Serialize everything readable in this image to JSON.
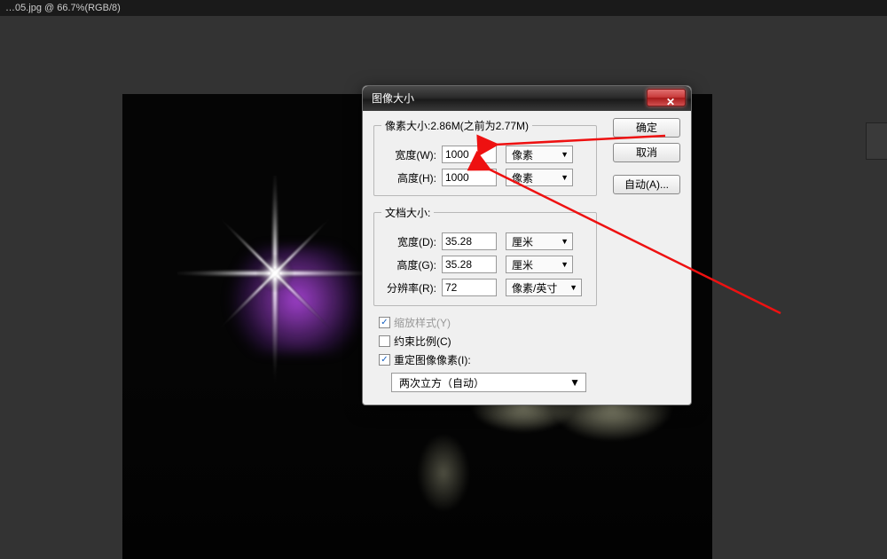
{
  "tab": {
    "title": "…05.jpg @ 66.7%(RGB/8)"
  },
  "dialog": {
    "title": "图像大小",
    "buttons": {
      "ok": "确定",
      "cancel": "取消",
      "auto": "自动(A)..."
    },
    "pixelDims": {
      "legend": "像素大小:2.86M(之前为2.77M)",
      "widthLabel": "宽度(W):",
      "widthValue": "1000",
      "widthUnit": "像素",
      "heightLabel": "高度(H):",
      "heightValue": "1000",
      "heightUnit": "像素"
    },
    "docSize": {
      "legend": "文档大小:",
      "widthLabel": "宽度(D):",
      "widthValue": "35.28",
      "widthUnit": "厘米",
      "heightLabel": "高度(G):",
      "heightValue": "35.28",
      "heightUnit": "厘米",
      "resLabel": "分辨率(R):",
      "resValue": "72",
      "resUnit": "像素/英寸"
    },
    "scaleStyles": "缩放样式(Y)",
    "constrain": "约束比例(C)",
    "resample": "重定图像像素(I):",
    "resampleMode": "两次立方（自动）"
  }
}
